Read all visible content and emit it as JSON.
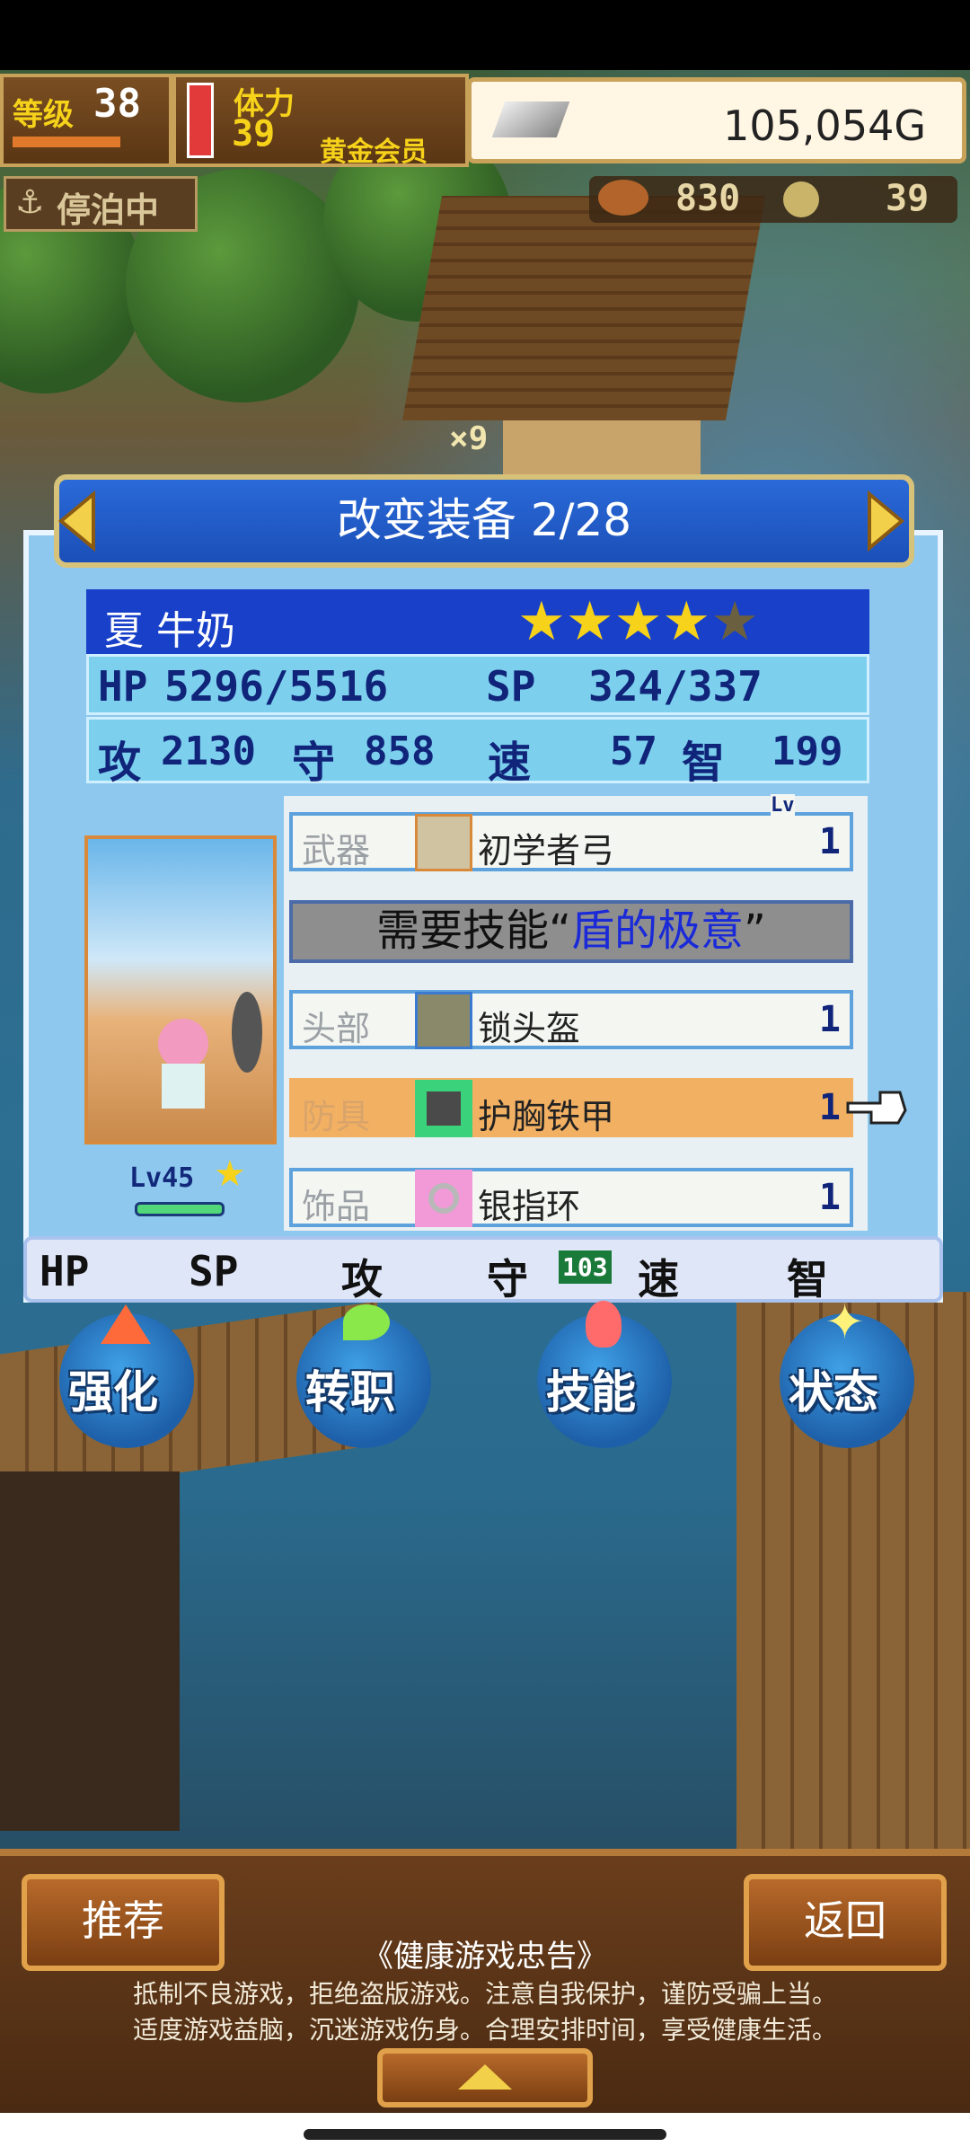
{
  "hud": {
    "level_label": "等级",
    "level_value": "38",
    "stamina_label": "体力",
    "stamina_value": "39",
    "membership": "黄金会员",
    "gold": "105,054G",
    "docked_label": "停泊中",
    "resource1_value": "830",
    "resource2_value": "39"
  },
  "scene": {
    "house_count": "×9"
  },
  "panel": {
    "title": "改变装备 2/28",
    "char_name": "夏 牛奶",
    "stars_total": 5,
    "stars_filled": 4,
    "stats": {
      "hp_label": "HP",
      "hp_value": "5296/5516",
      "sp_label": "SP",
      "sp_value": "324/337",
      "atk_label": "攻",
      "atk_value": "2130",
      "def_label": "守",
      "def_value": "858",
      "spd_label": "速",
      "spd_value": "57",
      "int_label": "智",
      "int_value": "199"
    },
    "portrait_level": "Lv45",
    "equipment": [
      {
        "slot": "武器",
        "item": "初学者弓",
        "level": "1",
        "lv_tag": "Lv"
      },
      {
        "slot": "头部",
        "item": "锁头盔",
        "level": "1"
      },
      {
        "slot": "防具",
        "item": "护胸铁甲",
        "level": "1"
      },
      {
        "slot": "饰品",
        "item": "银指环",
        "level": "1"
      }
    ],
    "skill_req_prefix": "需要技能“",
    "skill_req_name": "盾的极意",
    "skill_req_suffix": "”",
    "compare_row": {
      "hp": "HP",
      "sp": "SP",
      "atk": "攻",
      "def": "守",
      "def_diff": "103",
      "spd": "速",
      "int": "智"
    }
  },
  "actions": [
    {
      "label": "强化",
      "icon": "arrow-up-icon"
    },
    {
      "label": "转职",
      "icon": "leaf-icon"
    },
    {
      "label": "技能",
      "icon": "flame-icon"
    },
    {
      "label": "状态",
      "icon": "sparkle-icon"
    }
  ],
  "bottom": {
    "recommend_button": "推荐",
    "back_button": "返回",
    "notice_title": "《健康游戏忠告》",
    "notice_line1": "抵制不良游戏，拒绝盗版游戏。注意自我保护，谨防受骗上当。",
    "notice_line2": "适度游戏益脑，沉迷游戏伤身。合理安排时间，享受健康生活。"
  },
  "colors": {
    "panel_blue": "#8ec8ee",
    "header_blue": "#1b4fb8",
    "highlight_row": "#f2b063",
    "star_gold": "#f6d21a",
    "req_name_blue": "#1a2ad8"
  }
}
